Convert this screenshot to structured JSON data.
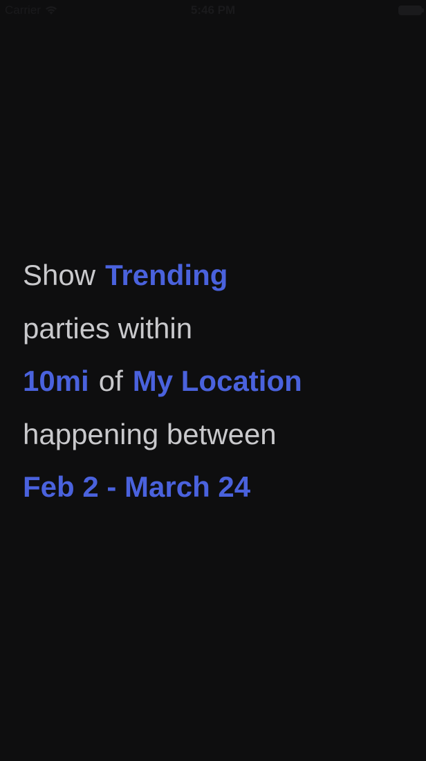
{
  "status_bar": {
    "carrier": "Carrier",
    "time": "5:46 PM",
    "icons": [
      "wifi-icon",
      "battery-icon"
    ]
  },
  "filter_sentence": {
    "show_prefix": "Show",
    "sort_option": "Trending",
    "parties_text": "parties within",
    "distance_option": "10mi",
    "of_text": "of",
    "location_option": "My Location",
    "happening_text": "happening between",
    "date_range_option": "Feb 2 - March 24"
  },
  "colors": {
    "background": "#0e0e0f",
    "static_text": "#c9c9cc",
    "accent": "#4a62dd"
  }
}
